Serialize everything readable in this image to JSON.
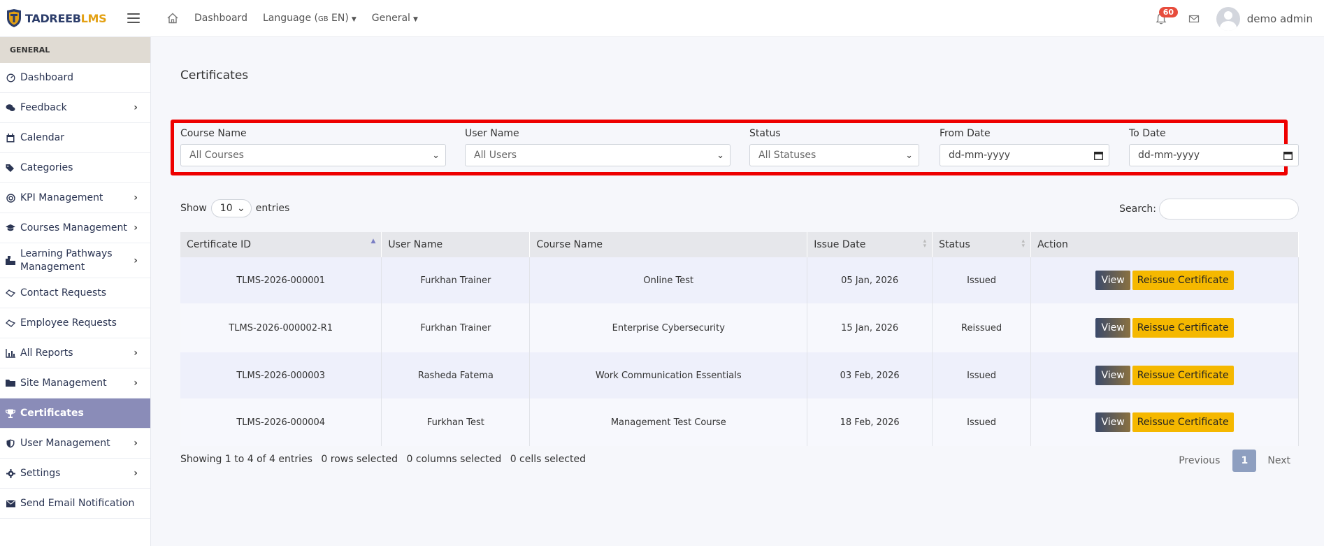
{
  "brand": {
    "name_part1": "TADREEB",
    "name_part2": "LMS"
  },
  "topbar": {
    "dashboard": "Dashboard",
    "language_prefix": "Language (",
    "language_code": "GB",
    "language_suffix": " EN)",
    "general": "General",
    "notification_count": "60",
    "user_name": "demo admin"
  },
  "sidebar": {
    "header": "GENERAL",
    "items": [
      {
        "label": "Dashboard",
        "icon": "gauge-icon",
        "chevron": ""
      },
      {
        "label": "Feedback",
        "icon": "comments-icon",
        "chevron": "›"
      },
      {
        "label": "Calendar",
        "icon": "calendar-icon",
        "chevron": ""
      },
      {
        "label": "Categories",
        "icon": "tags-icon",
        "chevron": ""
      },
      {
        "label": "KPI Management",
        "icon": "target-icon",
        "chevron": "›"
      },
      {
        "label": "Courses Management",
        "icon": "graduation-cap-icon",
        "chevron": "›"
      },
      {
        "label": "Learning Pathways Management",
        "icon": "sitemap-icon",
        "chevron": "›"
      },
      {
        "label": "Contact Requests",
        "icon": "handshake-icon",
        "chevron": ""
      },
      {
        "label": "Employee Requests",
        "icon": "handshake-icon",
        "chevron": ""
      },
      {
        "label": "All Reports",
        "icon": "chart-icon",
        "chevron": "›"
      },
      {
        "label": "Site Management",
        "icon": "folder-icon",
        "chevron": "›"
      },
      {
        "label": "Certificates",
        "icon": "trophy-icon",
        "chevron": ""
      },
      {
        "label": "User Management",
        "icon": "shield-icon",
        "chevron": "›"
      },
      {
        "label": "Settings",
        "icon": "gear-icon",
        "chevron": "›"
      },
      {
        "label": "Send Email Notification",
        "icon": "envelope-icon",
        "chevron": ""
      }
    ]
  },
  "page": {
    "title": "Certificates"
  },
  "filters": {
    "course_label": "Course Name",
    "course_value": "All Courses",
    "user_label": "User Name",
    "user_value": "All Users",
    "status_label": "Status",
    "status_value": "All Statuses",
    "from_label": "From Date",
    "from_placeholder": "dd-mm-yyyy",
    "to_label": "To Date",
    "to_placeholder": "dd-mm-yyyy"
  },
  "table_controls": {
    "show": "Show",
    "entries_value": "10",
    "entries": "entries",
    "search": "Search:"
  },
  "table": {
    "headers": [
      "Certificate ID",
      "User Name",
      "Course Name",
      "Issue Date",
      "Status",
      "Action"
    ],
    "rows": [
      {
        "id": "TLMS-2026-000001",
        "user": "Furkhan Trainer",
        "course": "Online Test",
        "date": "05 Jan, 2026",
        "status": "Issued"
      },
      {
        "id": "TLMS-2026-000002-R1",
        "user": "Furkhan Trainer",
        "course": "Enterprise Cybersecurity",
        "date": "15 Jan, 2026",
        "status": "Reissued"
      },
      {
        "id": "TLMS-2026-000003",
        "user": "Rasheda Fatema",
        "course": "Work Communication Essentials",
        "date": "03 Feb, 2026",
        "status": "Issued"
      },
      {
        "id": "TLMS-2026-000004",
        "user": "Furkhan Test",
        "course": "Management Test Course",
        "date": "18 Feb, 2026",
        "status": "Issued"
      }
    ],
    "view_label": "View",
    "reissue_label": "Reissue Certificate"
  },
  "footer": {
    "showing": "Showing 1 to 4 of 4 entries",
    "rows_selected": "0 rows selected",
    "columns_selected": "0 columns selected",
    "cells_selected": "0 cells selected",
    "previous": "Previous",
    "page": "1",
    "next": "Next"
  },
  "colors": {
    "accent": "#8a8cb8",
    "highlight_border": "#ee0000",
    "reissue": "#f5b800",
    "brand_gold": "#e3a114",
    "brand_navy": "#2d3e6b"
  }
}
